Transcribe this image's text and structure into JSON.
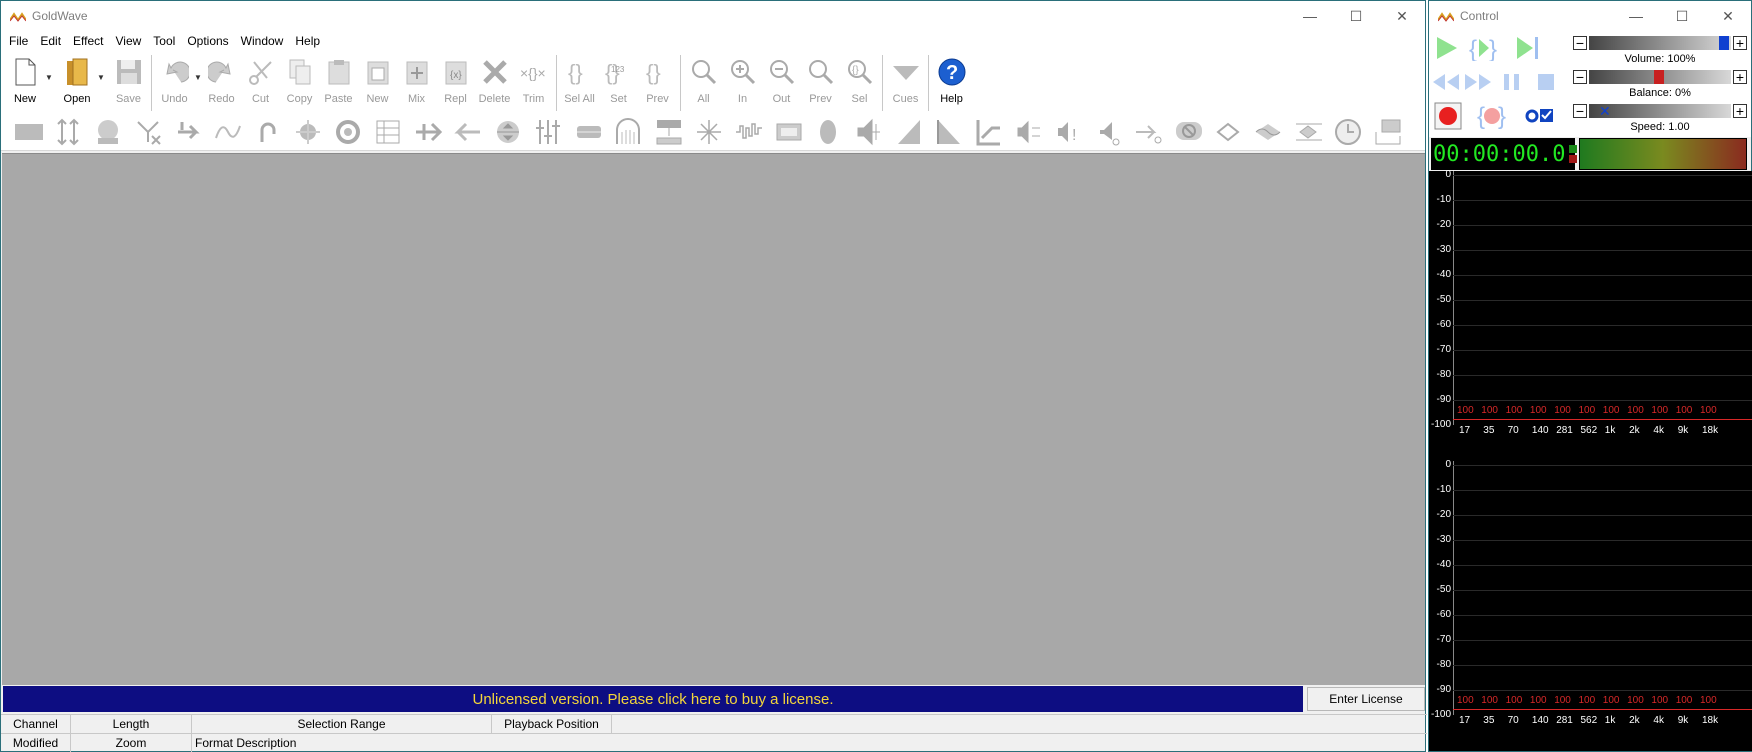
{
  "main_window": {
    "title": "GoldWave",
    "menu": [
      "File",
      "Edit",
      "Effect",
      "View",
      "Tool",
      "Options",
      "Window",
      "Help"
    ],
    "toolbar": [
      {
        "label": "New",
        "icon": "new-file-icon",
        "enabled": true
      },
      {
        "label": "Open",
        "icon": "open-folder-icon",
        "enabled": true
      },
      {
        "label": "Save",
        "icon": "save-disk-icon",
        "enabled": false
      },
      {
        "label": "Undo",
        "icon": "undo-icon",
        "enabled": false
      },
      {
        "label": "Redo",
        "icon": "redo-icon",
        "enabled": false
      },
      {
        "label": "Cut",
        "icon": "scissors-icon",
        "enabled": false
      },
      {
        "label": "Copy",
        "icon": "copy-icon",
        "enabled": false
      },
      {
        "label": "Paste",
        "icon": "paste-icon",
        "enabled": false
      },
      {
        "label": "New",
        "icon": "paste-new-icon",
        "enabled": false
      },
      {
        "label": "Mix",
        "icon": "mix-icon",
        "enabled": false
      },
      {
        "label": "Repl",
        "icon": "replace-icon",
        "enabled": false
      },
      {
        "label": "Delete",
        "icon": "delete-x-icon",
        "enabled": false
      },
      {
        "label": "Trim",
        "icon": "trim-icon",
        "enabled": false
      },
      {
        "label": "Sel All",
        "icon": "select-all-icon",
        "enabled": false
      },
      {
        "label": "Set",
        "icon": "set-selection-icon",
        "enabled": false
      },
      {
        "label": "Prev",
        "icon": "previous-selection-icon",
        "enabled": false
      },
      {
        "label": "All",
        "icon": "zoom-all-icon",
        "enabled": false
      },
      {
        "label": "In",
        "icon": "zoom-in-icon",
        "enabled": false
      },
      {
        "label": "Out",
        "icon": "zoom-out-icon",
        "enabled": false
      },
      {
        "label": "Prev",
        "icon": "zoom-previous-icon",
        "enabled": false
      },
      {
        "label": "Sel",
        "icon": "zoom-selection-icon",
        "enabled": false
      },
      {
        "label": "Cues",
        "icon": "cues-icon",
        "enabled": false
      },
      {
        "label": "Help",
        "icon": "help-icon",
        "enabled": true
      }
    ],
    "license_banner": "Unlicensed version. Please click here to buy a license.",
    "enter_license": "Enter License",
    "status_row1": [
      "Channel",
      "Length",
      "Selection Range",
      "Playback Position",
      ""
    ],
    "status_row2": [
      "Modified",
      "Zoom",
      "Format Description"
    ]
  },
  "control_window": {
    "title": "Control",
    "volume_label": "Volume: 100%",
    "balance_label": "Balance: 0%",
    "speed_label": "Speed: 1.00",
    "volume": 1.0,
    "balance": 0.0,
    "speed": 1.0,
    "time": "00:00:00.0",
    "spectrum": {
      "y_labels": [
        "0",
        "-10",
        "-20",
        "-30",
        "-40",
        "-50",
        "-60",
        "-70",
        "-80",
        "-90",
        "-100"
      ],
      "x_labels": [
        "17",
        "35",
        "70",
        "140",
        "281",
        "562",
        "1k",
        "2k",
        "4k",
        "9k",
        "18k"
      ],
      "peak_labels": [
        "100",
        "100",
        "100",
        "100",
        "100",
        "100",
        "100",
        "100",
        "100",
        "100",
        "100"
      ]
    }
  },
  "colors": {
    "license_bg": "#0d0d82",
    "license_text": "#f4d63a",
    "canvas": "#a8a8a8",
    "time_text": "#22e822",
    "peak_text": "#d82828"
  }
}
